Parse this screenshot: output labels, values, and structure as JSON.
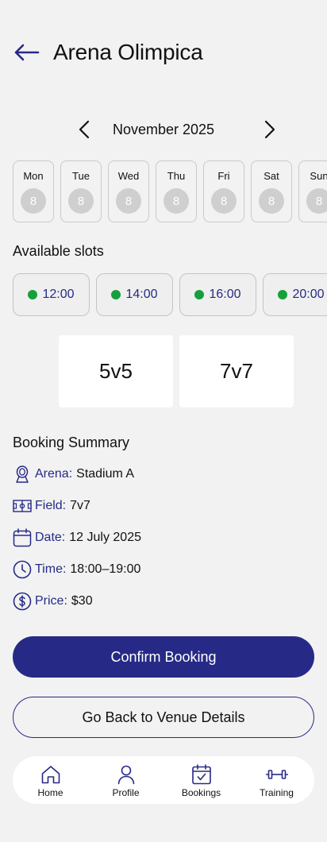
{
  "header": {
    "title": "Arena Olimpica"
  },
  "calendar": {
    "month_label": "November 2025",
    "days": [
      {
        "name": "Mon",
        "num": "8"
      },
      {
        "name": "Tue",
        "num": "8"
      },
      {
        "name": "Wed",
        "num": "8"
      },
      {
        "name": "Thu",
        "num": "8"
      },
      {
        "name": "Fri",
        "num": "8"
      },
      {
        "name": "Sat",
        "num": "8"
      },
      {
        "name": "Sun",
        "num": "8"
      }
    ]
  },
  "slots": {
    "title": "Available slots",
    "items": [
      {
        "time": "12:00",
        "status": "available"
      },
      {
        "time": "14:00",
        "status": "available"
      },
      {
        "time": "16:00",
        "status": "available"
      },
      {
        "time": "20:00",
        "status": "available"
      }
    ]
  },
  "formats": [
    "5v5",
    "7v7"
  ],
  "summary": {
    "title": "Booking Summary",
    "rows": [
      {
        "icon": "stadium-icon",
        "key": "Arena:",
        "value": "Stadium A"
      },
      {
        "icon": "field-icon",
        "key": "Field:",
        "value": "7v7"
      },
      {
        "icon": "calendar-icon",
        "key": "Date:",
        "value": "12 July 2025"
      },
      {
        "icon": "clock-icon",
        "key": "Time:",
        "value": "18:00–19:00"
      },
      {
        "icon": "dollar-icon",
        "key": "Price:",
        "value": "$30"
      }
    ]
  },
  "actions": {
    "confirm_label": "Confirm Booking",
    "back_label": "Go Back to Venue Details"
  },
  "bottom_nav": [
    {
      "icon": "home-icon",
      "label": "Home"
    },
    {
      "icon": "profile-icon",
      "label": "Profile"
    },
    {
      "icon": "bookings-icon",
      "label": "Bookings"
    },
    {
      "icon": "training-icon",
      "label": "Training"
    }
  ],
  "colors": {
    "primary": "#262a86",
    "available": "#15a03c",
    "background": "#f2f2f2"
  }
}
